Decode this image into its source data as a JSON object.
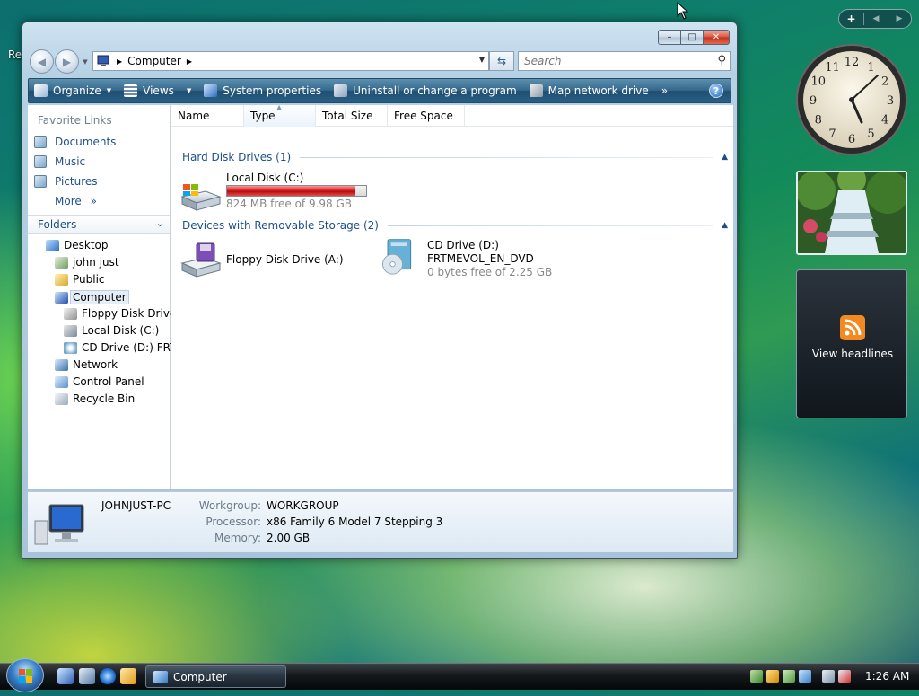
{
  "desktop": {
    "partial_label": "Re"
  },
  "window": {
    "title_buttons": {
      "minimize": "–",
      "maximize": "□",
      "close": "✕"
    },
    "address": {
      "crumbs": [
        "Computer"
      ]
    },
    "search": {
      "placeholder": "Search"
    },
    "command_bar": {
      "organize": "Organize",
      "views": "Views",
      "system_properties": "System properties",
      "uninstall": "Uninstall or change a program",
      "map_drive": "Map network drive",
      "overflow": "»",
      "help": "?"
    },
    "favorite_links": {
      "title": "Favorite Links",
      "items": [
        "Documents",
        "Music",
        "Pictures"
      ],
      "more": "More"
    },
    "folders": {
      "title": "Folders",
      "items": [
        {
          "label": "Desktop"
        },
        {
          "label": "john just"
        },
        {
          "label": "Public"
        },
        {
          "label": "Computer"
        },
        {
          "label": "Floppy Disk Drive"
        },
        {
          "label": "Local Disk (C:)"
        },
        {
          "label": "CD Drive (D:) FRTI"
        },
        {
          "label": "Network"
        },
        {
          "label": "Control Panel"
        },
        {
          "label": "Recycle Bin"
        }
      ]
    },
    "columns": [
      "Name",
      "Type",
      "Total Size",
      "Free Space"
    ],
    "groups": {
      "hard_disk": "Hard Disk Drives (1)",
      "removable": "Devices with Removable Storage (2)"
    },
    "drives": {
      "local_disk": {
        "name": "Local Disk (C:)",
        "free": "824 MB free of 9.98 GB",
        "used_fraction": 0.92
      },
      "floppy": {
        "name": "Floppy Disk Drive (A:)"
      },
      "cd": {
        "name": "CD Drive (D:)",
        "label": "FRTMEVOL_EN_DVD",
        "free": "0 bytes free of 2.25 GB"
      }
    },
    "details": {
      "pc_name": "JOHNJUST-PC",
      "workgroup_key": "Workgroup:",
      "workgroup": "WORKGROUP",
      "processor_key": "Processor:",
      "processor": "x86 Family 6 Model 7 Stepping 3",
      "memory_key": "Memory:",
      "memory": "2.00 GB"
    }
  },
  "sidebar": {
    "toolbar": {
      "add": "+",
      "prev": "◀",
      "next": "▶"
    },
    "clock_numbers": [
      "12",
      "1",
      "2",
      "3",
      "4",
      "5",
      "6",
      "7",
      "8",
      "9",
      "10",
      "11"
    ],
    "feed_label": "View headlines"
  },
  "taskbar": {
    "active_window": "Computer",
    "time": "1:26 AM"
  },
  "colors": {
    "accent": "#1e4f8a",
    "capacity_full": "#da2424",
    "command_bar": "#2a5f85"
  }
}
